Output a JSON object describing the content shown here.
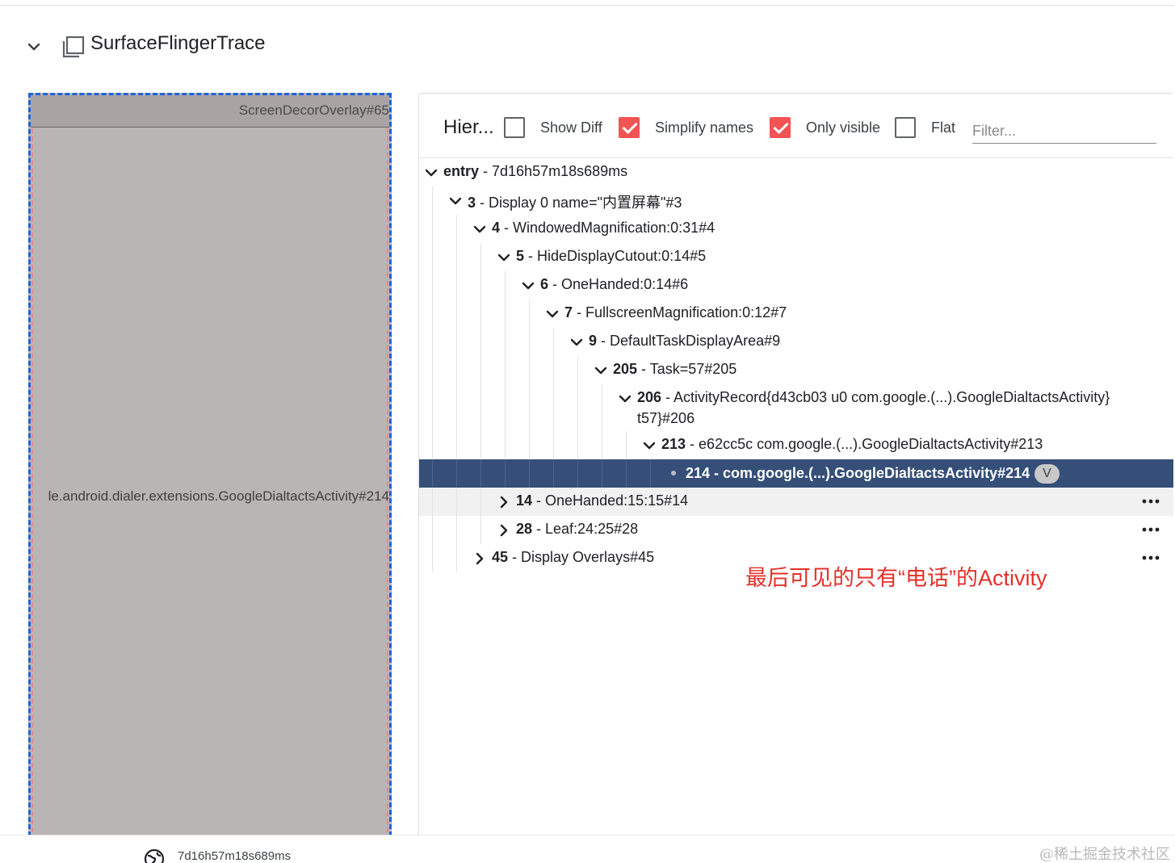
{
  "header": {
    "title": "SurfaceFlingerTrace"
  },
  "rects": {
    "top_label": "ScreenDecorOverlay#65",
    "middle_label": "le.android.dialer.extensions.GoogleDialtactsActivity#214"
  },
  "toolbar": {
    "title": "Hier...",
    "options": [
      {
        "label": "Show Diff",
        "checked": false
      },
      {
        "label": "Simplify names",
        "checked": true
      },
      {
        "label": "Only visible",
        "checked": true
      },
      {
        "label": "Flat",
        "checked": false
      }
    ],
    "filter_placeholder": "Filter..."
  },
  "tree": [
    {
      "id": "entry",
      "rest": " - 7d16h57m18s689ms",
      "depth": 0,
      "state": "expanded"
    },
    {
      "id": "3",
      "rest": " - Display 0 name=\"内置屏幕\"#3",
      "depth": 1,
      "state": "expanded"
    },
    {
      "id": "4",
      "rest": " - WindowedMagnification:0:31#4",
      "depth": 2,
      "state": "expanded"
    },
    {
      "id": "5",
      "rest": " - HideDisplayCutout:0:14#5",
      "depth": 3,
      "state": "expanded"
    },
    {
      "id": "6",
      "rest": " - OneHanded:0:14#6",
      "depth": 4,
      "state": "expanded"
    },
    {
      "id": "7",
      "rest": " - FullscreenMagnification:0:12#7",
      "depth": 5,
      "state": "expanded"
    },
    {
      "id": "9",
      "rest": " - DefaultTaskDisplayArea#9",
      "depth": 6,
      "state": "expanded"
    },
    {
      "id": "205",
      "rest": " - Task=57#205",
      "depth": 7,
      "state": "expanded"
    },
    {
      "id": "206",
      "rest": " - ActivityRecord{d43cb03 u0 com.google.(...).GoogleDialtactsActivity}",
      "rest2": "t57}#206",
      "depth": 8,
      "state": "expanded"
    },
    {
      "id": "213",
      "rest": " - e62cc5c com.google.(...).GoogleDialtactsActivity#213",
      "depth": 9,
      "state": "expanded"
    },
    {
      "id": "214",
      "rest": " - com.google.(...).GoogleDialtactsActivity#214",
      "depth": 10,
      "state": "leaf",
      "selected": true,
      "chip": "V"
    },
    {
      "id": "14",
      "rest": " - OneHanded:15:15#14",
      "depth": 3,
      "state": "collapsed",
      "hovered": true,
      "more": true
    },
    {
      "id": "28",
      "rest": " - Leaf:24:25#28",
      "depth": 3,
      "state": "collapsed",
      "more": true
    },
    {
      "id": "45",
      "rest": " - Display Overlays#45",
      "depth": 2,
      "state": "collapsed",
      "more": true
    }
  ],
  "annotation": "最后可见的只有“电话”的Activity",
  "footer": {
    "timestamp": "7d16h57m18s689ms"
  },
  "watermark": "@稀土掘金技术社区",
  "colors": {
    "accent": "#f25353",
    "selected_row": "#354f78",
    "annotation": "#e5302a"
  }
}
